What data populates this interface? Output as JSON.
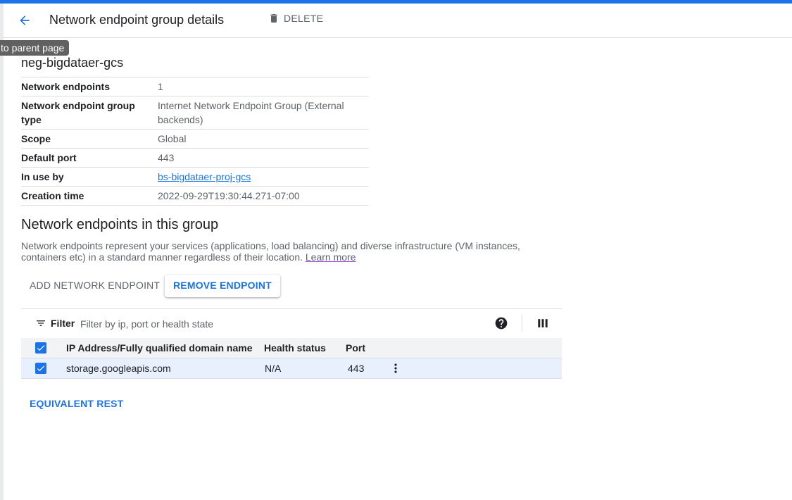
{
  "header": {
    "title": "Network endpoint group details",
    "delete_label": "DELETE",
    "tooltip": "to parent page"
  },
  "resource": {
    "name": "neg-bigdataer-gcs",
    "details": [
      {
        "key": "Network endpoints",
        "value": "1"
      },
      {
        "key": "Network endpoint group type",
        "value": "Internet Network Endpoint Group (External backends)"
      },
      {
        "key": "Scope",
        "value": "Global"
      },
      {
        "key": "Default port",
        "value": "443"
      },
      {
        "key": "In use by",
        "value": "bs-bigdataer-proj-gcs"
      },
      {
        "key": "Creation time",
        "value": "2022-09-29T19:30:44.271-07:00"
      }
    ]
  },
  "endpoints_section": {
    "title": "Network endpoints in this group",
    "description": "Network endpoints represent your services (applications, load balancing) and diverse infrastructure (VM instances, containers etc) in a standard manner regardless of their location.",
    "learn_more": "Learn more",
    "add_button": "ADD NETWORK ENDPOINT",
    "remove_button": "REMOVE ENDPOINT"
  },
  "filter": {
    "label": "Filter",
    "placeholder": "Filter by ip, port or health state"
  },
  "table": {
    "columns": [
      "IP Address/Fully qualified domain name",
      "Health status",
      "Port"
    ],
    "rows": [
      {
        "address": "storage.googleapis.com",
        "health": "N/A",
        "port": "443",
        "selected": true
      }
    ],
    "all_selected": true
  },
  "footer": {
    "equivalent_rest": "EQUIVALENT REST"
  },
  "colors": {
    "accent": "#1a73e8",
    "selected_row": "#e8f0fe"
  },
  "icons": {
    "back": "arrow-back-icon",
    "delete": "trash-icon",
    "filter": "filter-list-icon",
    "help": "help-circle-icon",
    "columns": "column-display-icon",
    "more": "more-vert-icon",
    "checkbox": "check-icon"
  }
}
